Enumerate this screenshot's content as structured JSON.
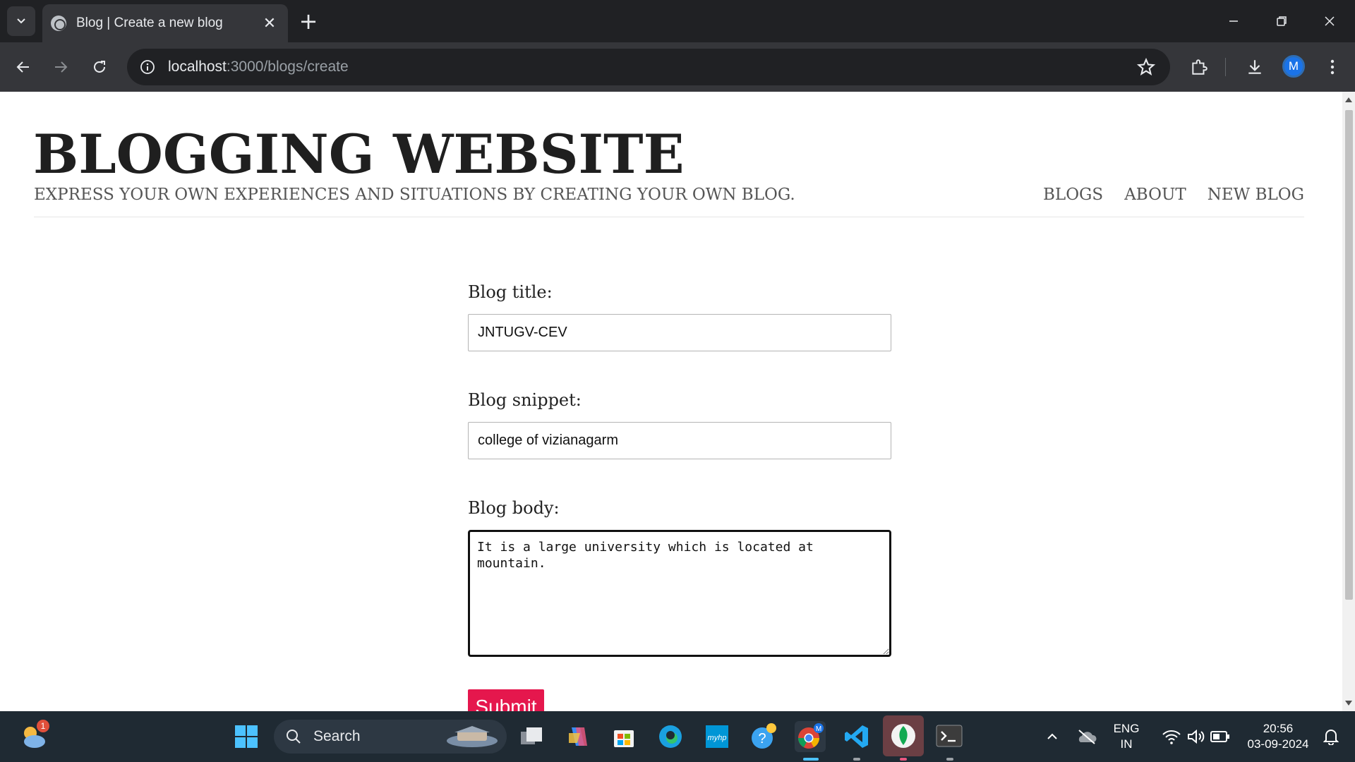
{
  "browser": {
    "tab_title": "Blog | Create a new blog",
    "url_host": "localhost",
    "url_path": ":3000/blogs/create",
    "profile_initial": "M"
  },
  "site": {
    "title": "BLOGGING WEBSITE",
    "subtitle": "EXPRESS YOUR OWN EXPERIENCES AND SITUATIONS BY CREATING YOUR OWN BLOG.",
    "nav": [
      {
        "label": "BLOGS"
      },
      {
        "label": "ABOUT"
      },
      {
        "label": "NEW BLOG"
      }
    ]
  },
  "form": {
    "title_label": "Blog title:",
    "title_value": "JNTUGV-CEV",
    "snippet_label": "Blog snippet:",
    "snippet_value": "college of vizianagarm",
    "body_label": "Blog body:",
    "body_value": "It is a large university which is located at mountain.",
    "submit_label": "Submit"
  },
  "taskbar": {
    "search_label": "Search",
    "weather_badge": "1",
    "language": "ENG",
    "region": "IN",
    "time": "20:56",
    "date": "03-09-2024"
  },
  "colors": {
    "submit": "#e5174d",
    "chrome_dark": "#202124",
    "chrome_toolbar": "#35363a",
    "taskbar": "#1f2a33"
  }
}
